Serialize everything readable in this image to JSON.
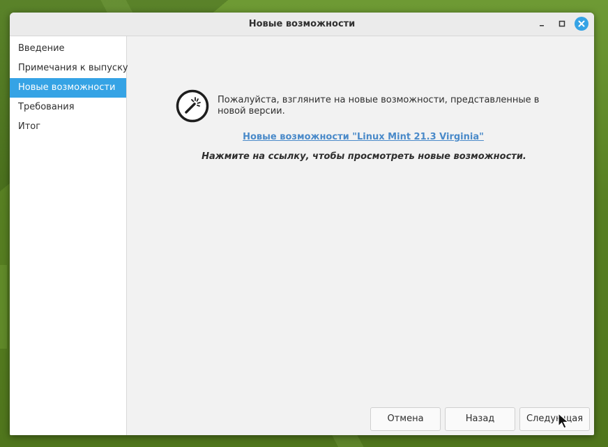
{
  "window": {
    "title": "Новые возможности"
  },
  "sidebar": {
    "items": [
      {
        "label": "Введение",
        "active": false
      },
      {
        "label": "Примечания к выпуску",
        "active": false
      },
      {
        "label": "Новые возможности",
        "active": true
      },
      {
        "label": "Требования",
        "active": false
      },
      {
        "label": "Итог",
        "active": false
      }
    ]
  },
  "main": {
    "icon": "magic-wand-icon",
    "intro_text": "Пожалуйста, взгляните на новые возможности, представленные в новой версии.",
    "link_text": "Новые возможности \"Linux Mint 21.3 Virginia\"",
    "hint_text": "Нажмите на ссылку, чтобы просмотреть новые возможности."
  },
  "buttons": {
    "cancel": "Отмена",
    "back": "Назад",
    "next": "Следующая"
  },
  "colors": {
    "accent": "#35a3e5",
    "link": "#4a8ac9"
  }
}
